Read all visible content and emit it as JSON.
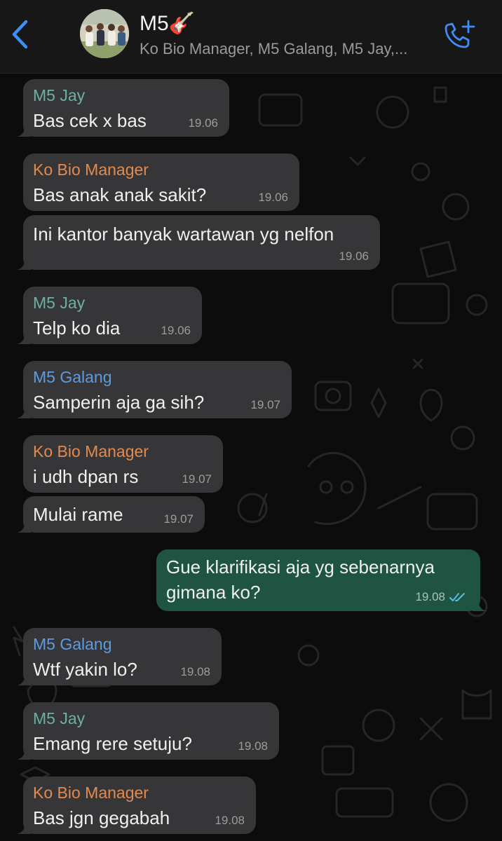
{
  "header": {
    "title": "M5🎸",
    "subtitle": "Ko Bio Manager, M5 Galang, M5 Jay,..."
  },
  "icons": {
    "back": "chevron-left-icon",
    "call": "add-call-icon",
    "read_status": "double-check-icon"
  },
  "colors": {
    "accent": "#3e8ef7",
    "sender_jay": "#6bb19f",
    "sender_bio": "#e48a4c",
    "sender_galang": "#5e9bdf",
    "incoming_bubble": "#363638",
    "outgoing_bubble": "#1f5442",
    "read_ticks": "#53bdeb"
  },
  "messages": [
    {
      "sender": "M5 Jay",
      "text": "Bas cek x bas",
      "time": "19.06"
    },
    {
      "sender": "Ko Bio Manager",
      "text": "Bas anak anak sakit?",
      "time": "19.06"
    },
    {
      "sender": "",
      "text": "Ini kantor banyak wartawan yg nelfon",
      "time": "19.06"
    },
    {
      "sender": "M5 Jay",
      "text": "Telp ko dia",
      "time": "19.06"
    },
    {
      "sender": "M5 Galang",
      "text": "Samperin aja ga sih?",
      "time": "19.07"
    },
    {
      "sender": "Ko Bio Manager",
      "text": "i udh dpan rs",
      "time": "19.07"
    },
    {
      "sender": "",
      "text": "Mulai rame",
      "time": "19.07"
    },
    {
      "sender": "",
      "outgoing": true,
      "lines": [
        "Gue klarifikasi aja yg sebenarnya",
        "gimana ko?"
      ],
      "time": "19.08"
    },
    {
      "sender": "M5 Galang",
      "text": "Wtf yakin lo?",
      "time": "19.08"
    },
    {
      "sender": "M5 Jay",
      "text": "Emang rere setuju?",
      "time": "19.08"
    },
    {
      "sender": "Ko Bio Manager",
      "text": "Bas jgn gegabah",
      "time": "19.08"
    }
  ]
}
